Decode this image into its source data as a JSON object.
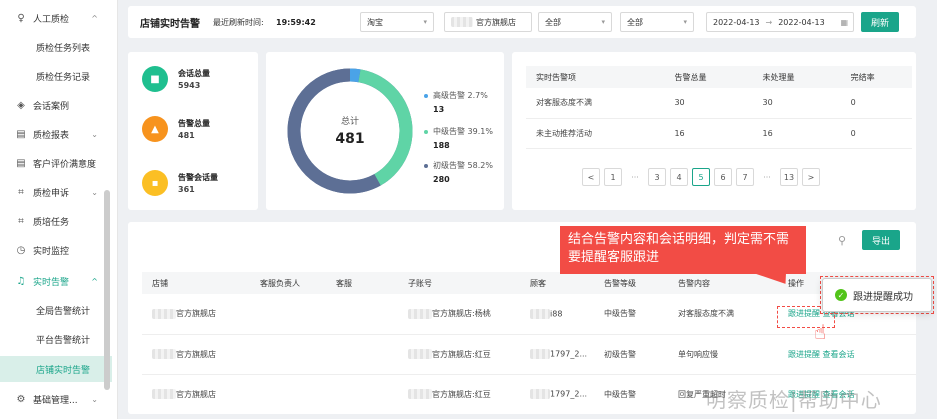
{
  "sidebar": {
    "items": [
      {
        "label": "人工质检",
        "icon": "person-icon",
        "type": "parent",
        "arrow": "^"
      },
      {
        "label": "质检任务列表",
        "type": "sub"
      },
      {
        "label": "质检任务记录",
        "type": "sub"
      },
      {
        "label": "会话案例",
        "icon": "layers-icon",
        "type": "top"
      },
      {
        "label": "质检报表",
        "icon": "report-icon",
        "type": "parent",
        "arrow": "⌄"
      },
      {
        "label": "客户评价满意度",
        "icon": "report-icon",
        "type": "top"
      },
      {
        "label": "质检申诉",
        "icon": "frame-icon",
        "type": "parent",
        "arrow": "⌄"
      },
      {
        "label": "质培任务",
        "icon": "frame-icon",
        "type": "top"
      },
      {
        "label": "实时监控",
        "icon": "clock-icon",
        "type": "top"
      },
      {
        "label": "实时告警",
        "icon": "bell-icon",
        "type": "active-parent",
        "arrow": "^"
      },
      {
        "label": "全局告警统计",
        "type": "sub"
      },
      {
        "label": "平台告警统计",
        "type": "sub"
      },
      {
        "label": "店铺实时告警",
        "type": "sub-active"
      },
      {
        "label": "基础管理...",
        "icon": "gear-icon",
        "type": "parent",
        "arrow": "⌄"
      }
    ]
  },
  "topbar": {
    "title": "店铺实时告警",
    "refresh_time_label": "最近刷新时间:",
    "refresh_time": "19:59:42",
    "platform_select": "淘宝",
    "shop_select": "官方旗舰店",
    "filter1": "全部",
    "filter2": "全部",
    "date_from": "2022-04-13",
    "date_sep": "→",
    "date_to": "2022-04-13",
    "refresh_button": "刷新"
  },
  "stats": [
    {
      "label": "会话总量",
      "value": "5943",
      "color": "#1fbf8f",
      "icon": "chat-icon"
    },
    {
      "label": "告警总量",
      "value": "481",
      "color": "#f7931e",
      "icon": "alarm-icon"
    },
    {
      "label": "告警会话量",
      "value": "361",
      "color": "#fbbf24",
      "icon": "message-icon"
    }
  ],
  "donut": {
    "center_label": "总计",
    "center_value": "481",
    "legend": [
      {
        "name": "高级告警",
        "pct": "2.7%",
        "value": "13",
        "color": "#4aa3e8"
      },
      {
        "name": "中级告警",
        "pct": "39.1%",
        "value": "188",
        "color": "#5fd4a6"
      },
      {
        "name": "初级告警",
        "pct": "58.2%",
        "value": "280",
        "color": "#5d6f95"
      }
    ]
  },
  "alert_table": {
    "headers": [
      "实时告警项",
      "告警总量",
      "未处理量",
      "完结率"
    ],
    "rows": [
      [
        "对客服态度不满",
        "30",
        "30",
        "0"
      ],
      [
        "未主动推荐活动",
        "16",
        "16",
        "0"
      ]
    ]
  },
  "pager": {
    "prev": "<",
    "next": ">",
    "pages": [
      "1",
      "···",
      "3",
      "4",
      "5",
      "6",
      "7",
      "···",
      "13"
    ],
    "active": "5"
  },
  "main": {
    "export_button": "导出",
    "headers": [
      "店铺",
      "客服负责人",
      "客服",
      "子账号",
      "顾客",
      "告警等级",
      "告警内容",
      "操作"
    ],
    "rows": [
      {
        "shop": "官方旗舰店",
        "sub_account": "官方旗舰店:杨桃",
        "customer": "i88",
        "level": "中级告警",
        "content": "对客服态度不满",
        "action1": "跟进提醒",
        "action2": "查看会话"
      },
      {
        "shop": "官方旗舰店",
        "sub_account": "官方旗舰店:红豆",
        "customer": "1797_2...",
        "level": "初级告警",
        "content": "单句响应慢",
        "action1": "跟进提醒",
        "action2": "查看会话"
      },
      {
        "shop": "官方旗舰店",
        "sub_account": "官方旗舰店:红豆",
        "customer": "1797_2...",
        "level": "中级告警",
        "content": "回复严重超时",
        "action1": "跟进提醒",
        "action2": "查看会话"
      }
    ]
  },
  "callout": {
    "text": "结合告警内容和会话明细，判定需不需要提醒客服跟进"
  },
  "toast": {
    "text": "跟进提醒成功"
  },
  "watermark": {
    "text": "明察质检|帮助中心"
  }
}
